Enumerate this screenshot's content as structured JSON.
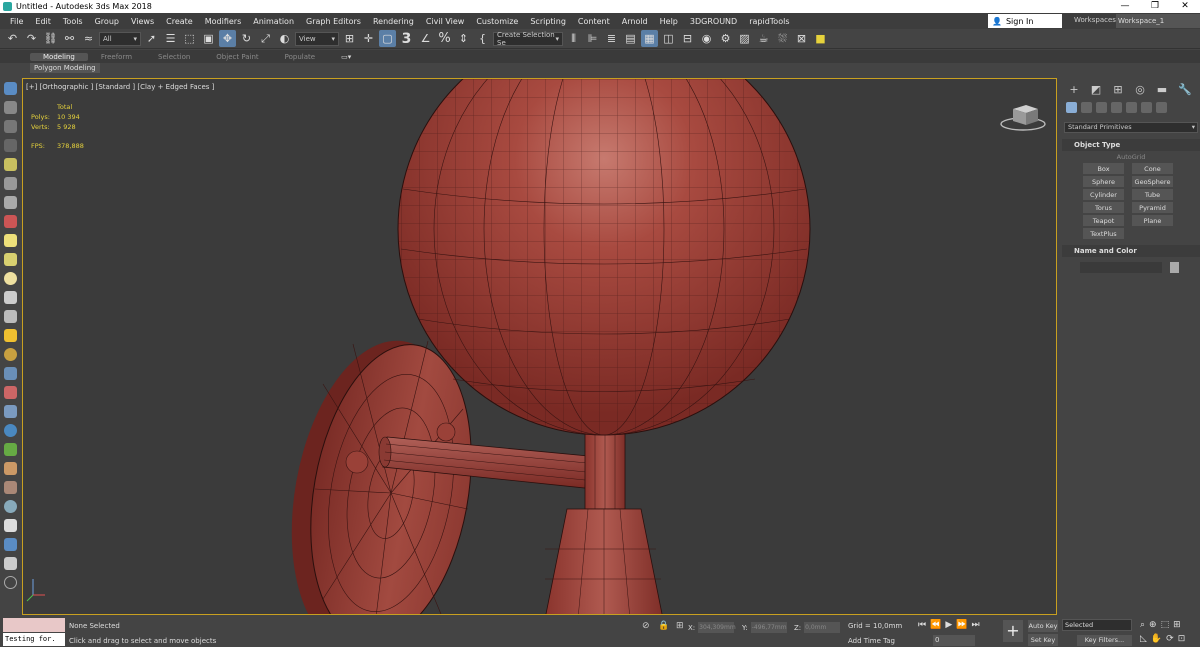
{
  "window": {
    "title": "Untitled - Autodesk 3ds Max 2018",
    "controls": [
      "—",
      "❐",
      "✕"
    ]
  },
  "menubar": {
    "items": [
      "File",
      "Edit",
      "Tools",
      "Group",
      "Views",
      "Create",
      "Modifiers",
      "Animation",
      "Graph Editors",
      "Rendering",
      "Civil View",
      "Customize",
      "Scripting",
      "Content",
      "Arnold",
      "Help",
      "3DGROUND",
      "rapidTools"
    ],
    "sign_in": "Sign In",
    "workspaces_label": "Workspaces:",
    "workspace_value": "Workspace_1"
  },
  "toolbar": {
    "selection_filter": "All",
    "ref_coord": "View",
    "named_selection": "Create Selection Se",
    "snap_label": "3",
    "percent_label": "%"
  },
  "ribbon": {
    "tabs": [
      "Modeling",
      "Freeform",
      "Selection",
      "Object Paint",
      "Populate"
    ],
    "active_tab": "Modeling",
    "sub_panel": "Polygon Modeling"
  },
  "viewport": {
    "label": "[+] [Orthographic ] [Standard ] [Clay + Edged Faces ]",
    "stats": {
      "header": "Total",
      "polys_label": "Polys:",
      "polys": "10 394",
      "verts_label": "Verts:",
      "verts": "5 928",
      "fps_label": "FPS:",
      "fps": "378,888"
    },
    "mesh_color": "#9c3a32"
  },
  "command_panel": {
    "category": "Standard Primitives",
    "object_type_title": "Object Type",
    "autogrid": "AutoGrid",
    "buttons": [
      "Box",
      "Cone",
      "Sphere",
      "GeoSphere",
      "Cylinder",
      "Tube",
      "Torus",
      "Pyramid",
      "Teapot",
      "Plane",
      "TextPlus"
    ],
    "name_color_title": "Name and Color"
  },
  "statusbar": {
    "maxscript_input": "Testing for.",
    "selection_status": "None Selected",
    "prompt": "Click and drag to select and move objects",
    "x_label": "X:",
    "x_value": "304,309mm",
    "y_label": "Y:",
    "y_value": "-496,77mm",
    "z_label": "Z:",
    "z_value": "0,0mm",
    "grid": "Grid = 10,0mm",
    "add_time_tag": "Add Time Tag",
    "frame": "0",
    "auto_key": "Auto Key",
    "set_key": "Set Key",
    "selected": "Selected",
    "key_filters": "Key Filters..."
  }
}
